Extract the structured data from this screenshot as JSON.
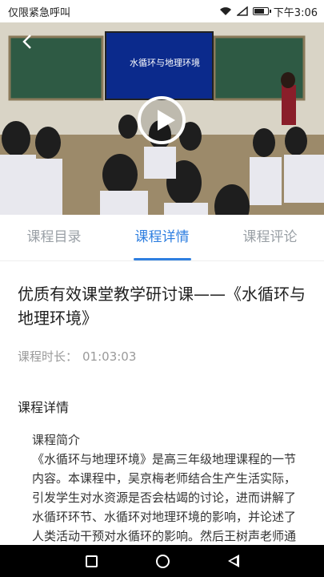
{
  "status_bar": {
    "left_text": "仅限紧急呼叫",
    "time": "下午3:06"
  },
  "video": {
    "slide_title": "水循环与地理环境",
    "playing": false
  },
  "tabs": [
    {
      "label": "课程目录",
      "active": false
    },
    {
      "label": "课程详情",
      "active": true
    },
    {
      "label": "课程评论",
      "active": false
    }
  ],
  "course": {
    "title": "优质有效课堂教学研讨课——《水循环与地理环境》",
    "duration_label": "课程时长：",
    "duration_value": "01:03:03"
  },
  "details": {
    "section_title": "课程详情",
    "intro_heading": "课程简介",
    "intro_text": "《水循环与地理环境》是高三年级地理课程的一节内容。本课程中，吴京梅老师结合生产生活实际，引发学生对水资源是否会枯竭的讨论，进而讲解了水循环环节、水循环对地理环境的影响，并论述了人类活动干预对水循环的影响。然后王树声老师通过对课堂展示与教学"
  },
  "colors": {
    "accent": "#2f7fe0",
    "tab_inactive": "#9aa0a6"
  }
}
